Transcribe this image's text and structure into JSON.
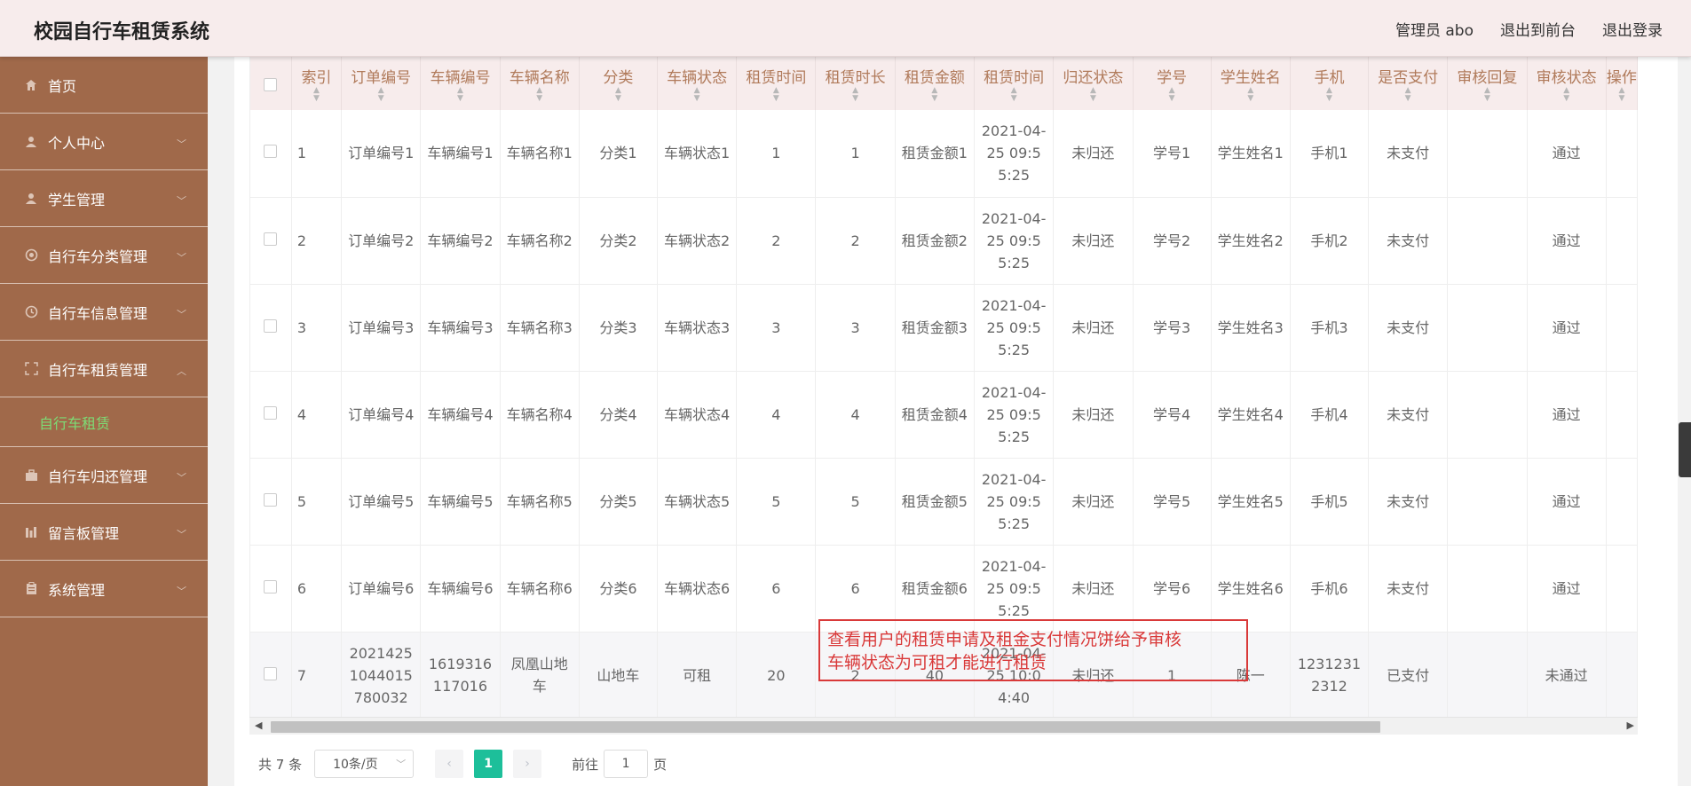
{
  "app": {
    "title": "校园自行车租赁系统",
    "admin_label": "管理员 abo",
    "front_label": "退出到前台",
    "logout_label": "退出登录"
  },
  "sidebar": {
    "items": [
      {
        "label": "首页",
        "icon": "home-icon"
      },
      {
        "label": "个人中心",
        "icon": "user-icon"
      },
      {
        "label": "学生管理",
        "icon": "user-icon"
      },
      {
        "label": "自行车分类管理",
        "icon": "circle-icon"
      },
      {
        "label": "自行车信息管理",
        "icon": "clock-icon"
      },
      {
        "label": "自行车租赁管理",
        "icon": "fullscreen-icon"
      },
      {
        "label": "自行车归还管理",
        "icon": "briefcase-icon"
      },
      {
        "label": "留言板管理",
        "icon": "chart-icon"
      },
      {
        "label": "系统管理",
        "icon": "clipboard-icon"
      }
    ],
    "active_sub": "自行车租赁"
  },
  "table": {
    "headers": [
      "",
      "索引",
      "订单编号",
      "车辆编号",
      "车辆名称",
      "分类",
      "车辆状态",
      "租赁时间",
      "租赁时长",
      "租赁金额",
      "租赁时间",
      "归还状态",
      "学号",
      "学生姓名",
      "手机",
      "是否支付",
      "审核回复",
      "审核状态",
      "操作"
    ],
    "rows": [
      [
        "1",
        "订单编号1",
        "车辆编号1",
        "车辆名称1",
        "分类1",
        "车辆状态1",
        "1",
        "1",
        "租赁金额1",
        "2021-04-25 09:55:25",
        "未归还",
        "学号1",
        "学生姓名1",
        "手机1",
        "未支付",
        "",
        "通过"
      ],
      [
        "2",
        "订单编号2",
        "车辆编号2",
        "车辆名称2",
        "分类2",
        "车辆状态2",
        "2",
        "2",
        "租赁金额2",
        "2021-04-25 09:55:25",
        "未归还",
        "学号2",
        "学生姓名2",
        "手机2",
        "未支付",
        "",
        "通过"
      ],
      [
        "3",
        "订单编号3",
        "车辆编号3",
        "车辆名称3",
        "分类3",
        "车辆状态3",
        "3",
        "3",
        "租赁金额3",
        "2021-04-25 09:55:25",
        "未归还",
        "学号3",
        "学生姓名3",
        "手机3",
        "未支付",
        "",
        "通过"
      ],
      [
        "4",
        "订单编号4",
        "车辆编号4",
        "车辆名称4",
        "分类4",
        "车辆状态4",
        "4",
        "4",
        "租赁金额4",
        "2021-04-25 09:55:25",
        "未归还",
        "学号4",
        "学生姓名4",
        "手机4",
        "未支付",
        "",
        "通过"
      ],
      [
        "5",
        "订单编号5",
        "车辆编号5",
        "车辆名称5",
        "分类5",
        "车辆状态5",
        "5",
        "5",
        "租赁金额5",
        "2021-04-25 09:55:25",
        "未归还",
        "学号5",
        "学生姓名5",
        "手机5",
        "未支付",
        "",
        "通过"
      ],
      [
        "6",
        "订单编号6",
        "车辆编号6",
        "车辆名称6",
        "分类6",
        "车辆状态6",
        "6",
        "6",
        "租赁金额6",
        "2021-04-25 09:55:25",
        "未归还",
        "学号6",
        "学生姓名6",
        "手机6",
        "未支付",
        "",
        "通过"
      ],
      [
        "7",
        "20214251044015780032",
        "1619316117016",
        "凤凰山地车",
        "山地车",
        "可租",
        "20",
        "2",
        "40",
        "2021-04-25 10:04:40",
        "未归还",
        "1",
        "陈一",
        "12312312312",
        "已支付",
        "",
        "未通过"
      ]
    ]
  },
  "pager": {
    "total": "共 7 条",
    "page_size": "10条/页",
    "prev": "‹",
    "current": "1",
    "next": "›",
    "goto_prefix": "前往",
    "goto_value": "1",
    "goto_suffix": "页"
  },
  "annotation": {
    "line1": "查看用户的租赁申请及租金支付情况饼给予审核",
    "line2": "车辆状态为可租才能进行租赁"
  }
}
